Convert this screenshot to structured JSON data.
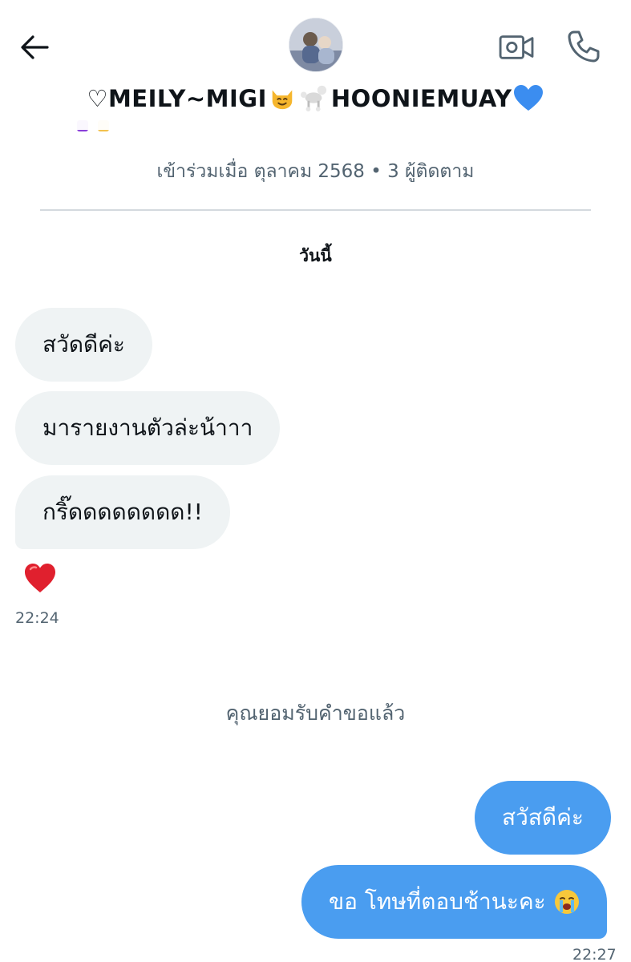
{
  "header": {
    "name_prefix": "♡",
    "name_part1": "MEILY~MIGI",
    "name_part2": "HOONIEMUAY",
    "icons": [
      "back-arrow-icon",
      "avatar",
      "video-call-icon",
      "phone-icon",
      "heart-outline-icon",
      "smiling-cat-icon",
      "poodle-icon",
      "blue-heart-icon"
    ]
  },
  "profile": {
    "join_info": "เข้าร่วมเมื่อ ตุลาคม 2568 • 3 ผู้ติดตาม"
  },
  "conversation": {
    "date_label": "วันนี้",
    "incoming": [
      {
        "text": "สวัดดีค่ะ"
      },
      {
        "text": "มารายงานตัวล่ะน้าาา"
      },
      {
        "text": "กริ๊ดดดดดดดด!!"
      }
    ],
    "reaction": "red-heart-icon",
    "incoming_time": "22:24",
    "system_note": "คุณยอมรับคำขอแล้ว",
    "outgoing": [
      {
        "text": "สวัสดีค่ะ"
      },
      {
        "text": "ขอ โทษที่ตอบช้านะคะ",
        "emoji": "loudly-crying-face-icon"
      }
    ],
    "outgoing_time": "22:27"
  },
  "colors": {
    "outgoing_bubble": "#4a9df0",
    "incoming_bubble": "#eff3f4",
    "secondary_text": "#536471",
    "heart_red": "#e0202e",
    "blue_heart": "#3b8df0"
  }
}
